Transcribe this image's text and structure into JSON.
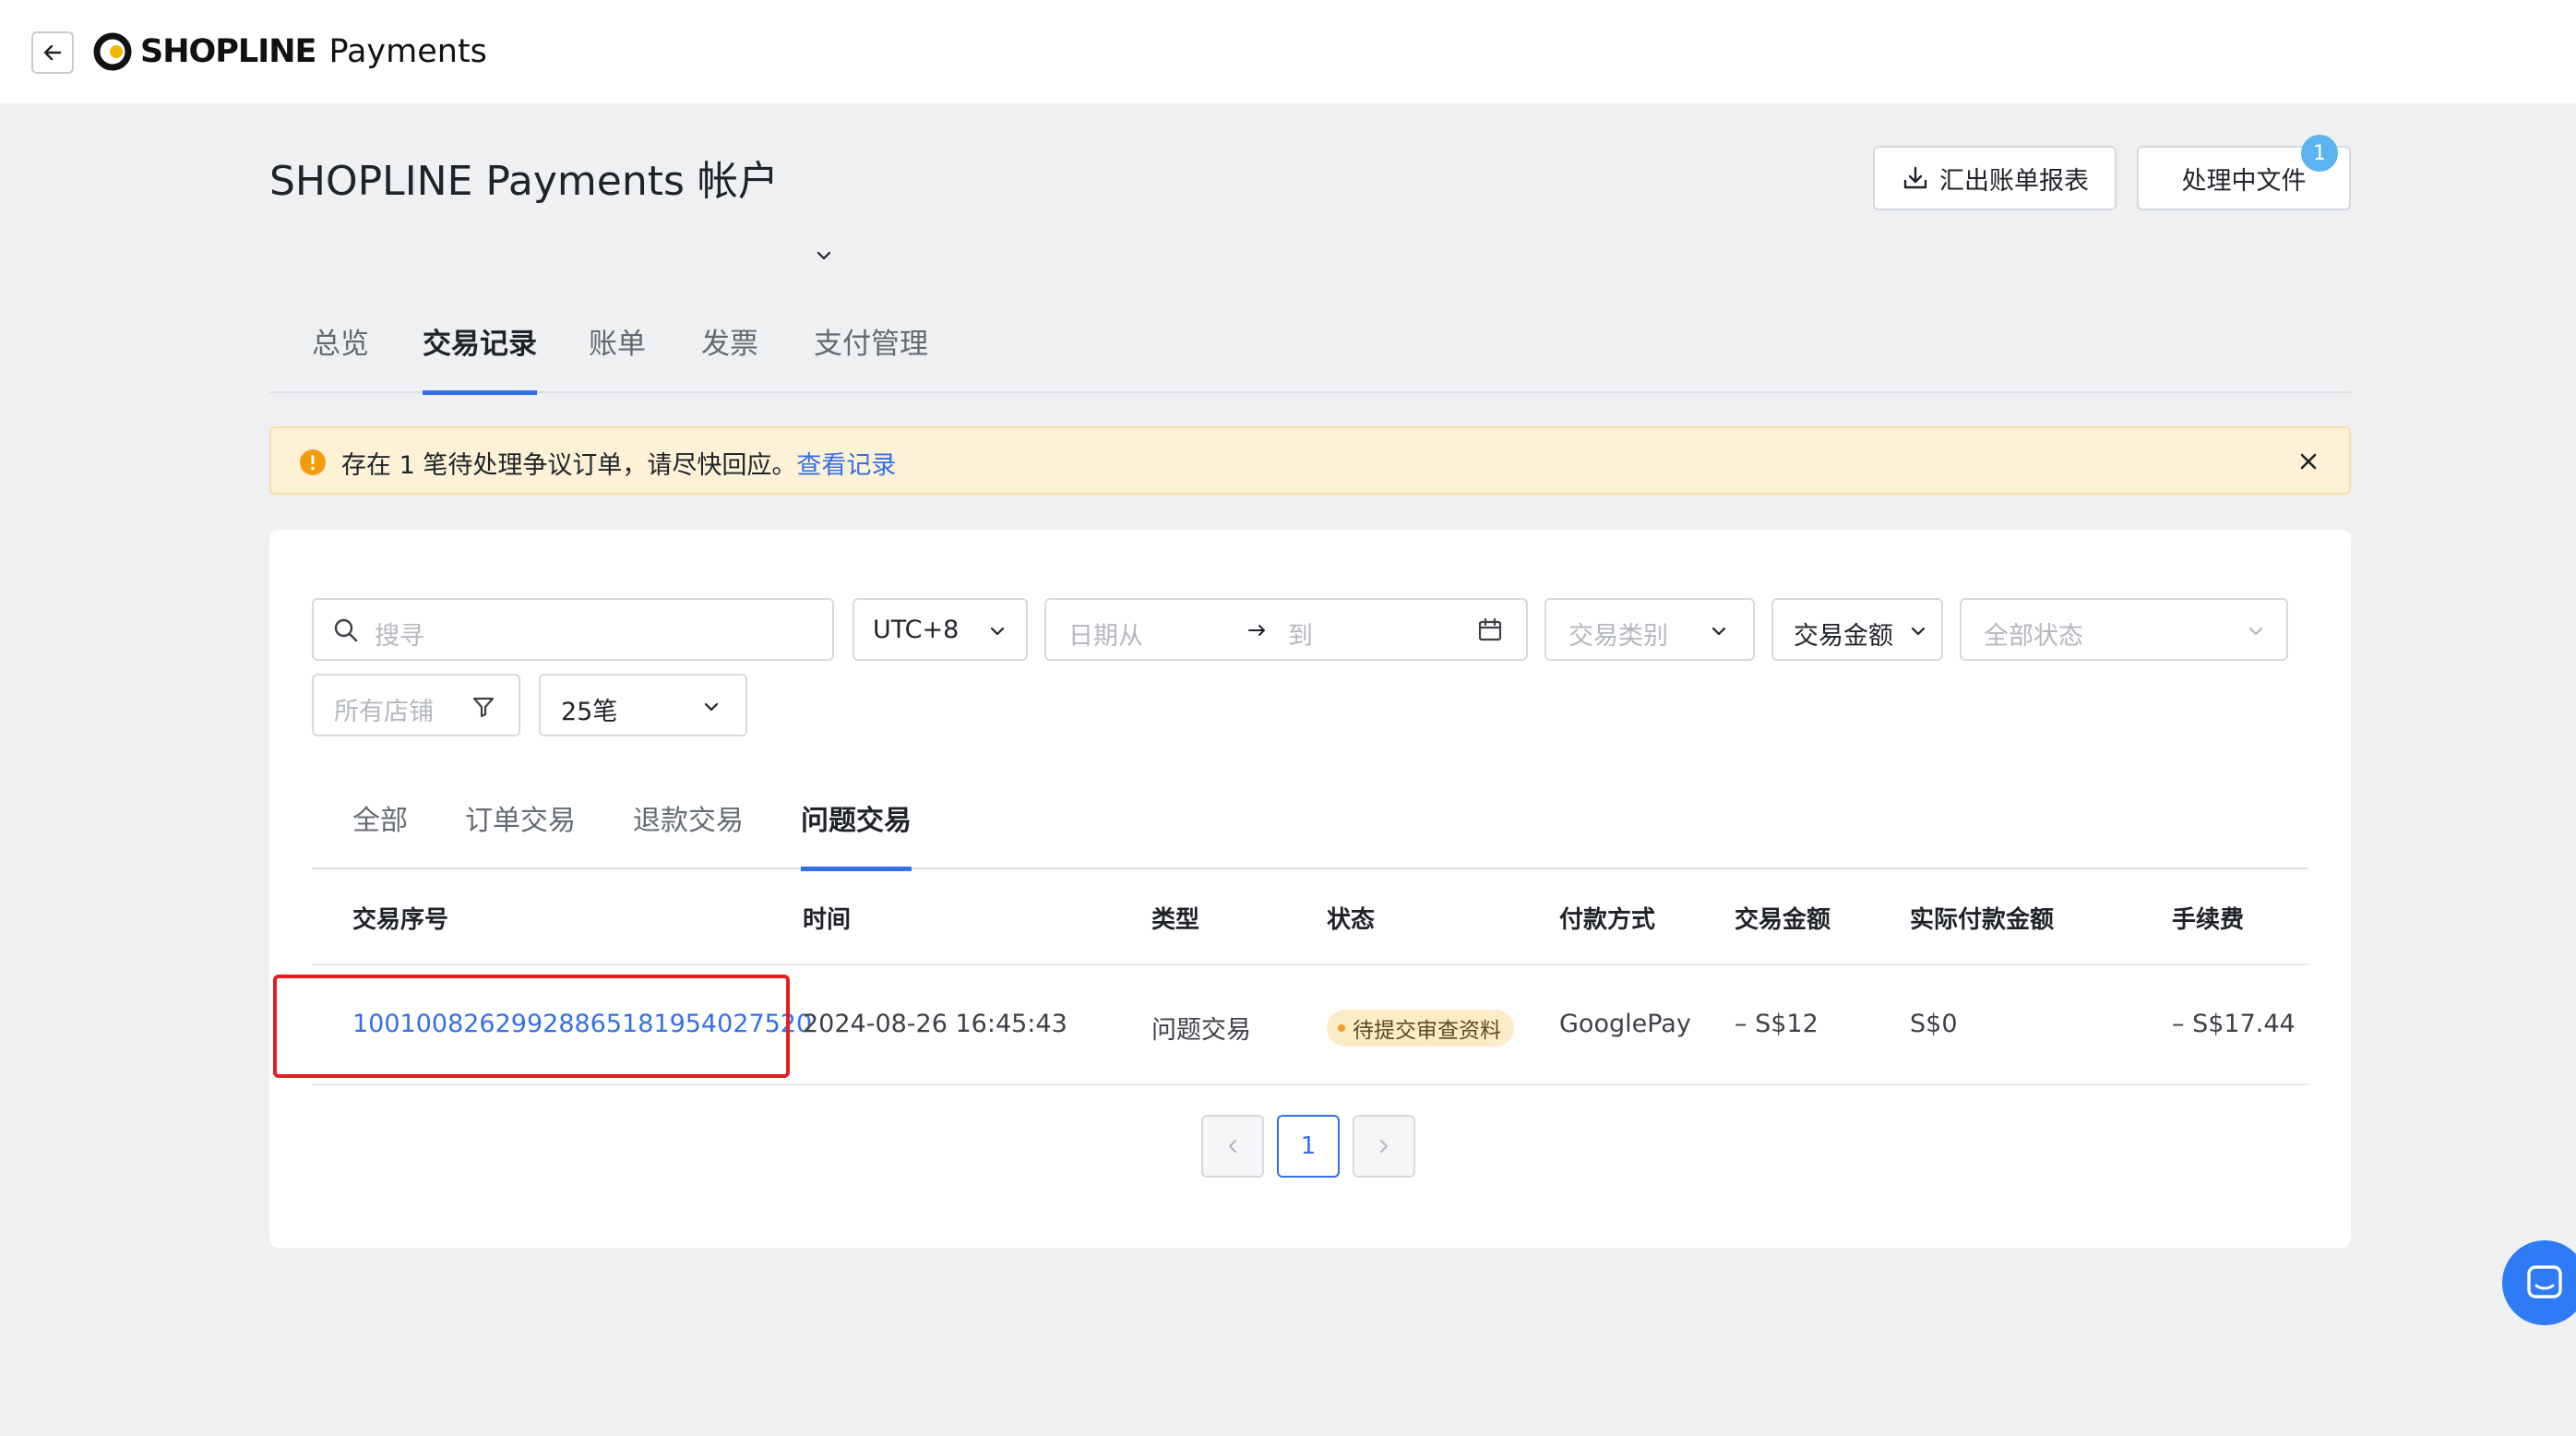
{
  "topbar": {
    "brand": "SHOPLINE",
    "product": "Payments"
  },
  "header": {
    "title": "SHOPLINE Payments 帐户",
    "export_label": "汇出账单报表",
    "processing_label": "处理中文件",
    "processing_badge": "1"
  },
  "main_tabs": [
    "总览",
    "交易记录",
    "账单",
    "发票",
    "支付管理"
  ],
  "alert": {
    "text": "存在 1 笔待处理争议订单，请尽快回应。",
    "link": "查看记录"
  },
  "filters": {
    "search_placeholder": "搜寻",
    "timezone": "UTC+8",
    "date_from_placeholder": "日期从",
    "date_to_placeholder": "到",
    "type_placeholder": "交易类别",
    "amount_label": "交易金额",
    "status_placeholder": "全部状态",
    "store_placeholder": "所有店铺",
    "page_size": "25笔"
  },
  "sub_tabs": [
    "全部",
    "订单交易",
    "退款交易",
    "问题交易"
  ],
  "table": {
    "columns": [
      "交易序号",
      "时间",
      "类型",
      "状态",
      "付款方式",
      "交易金额",
      "实际付款金额",
      "手续费"
    ],
    "rows": [
      {
        "id": "1001008262992886518195402752​0",
        "time": "2024-08-26 16:45:43",
        "type": "问题交易",
        "status": "待提交审查资料",
        "payment": "GooglePay",
        "amount": "– S$12",
        "actual": "S$0",
        "fee": "– S$17.44"
      }
    ]
  },
  "pagination": {
    "current": "1"
  },
  "colors": {
    "accent": "#3370e8",
    "alert_bg": "#fdf1d6",
    "highlight": "#e02020",
    "chat": "#2f7bf5"
  }
}
